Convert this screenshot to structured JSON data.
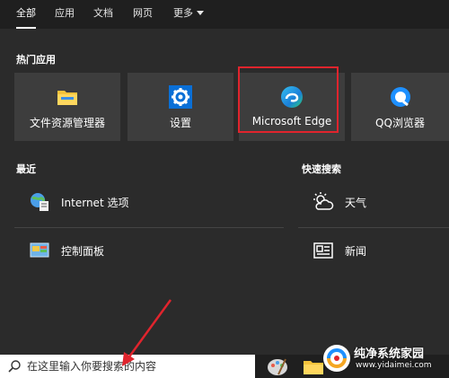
{
  "tabs": [
    {
      "label": "全部"
    },
    {
      "label": "应用"
    },
    {
      "label": "文档"
    },
    {
      "label": "网页"
    },
    {
      "label": "更多"
    }
  ],
  "hot_apps": {
    "title": "热门应用",
    "items": [
      {
        "label": "文件资源管理器",
        "icon": "folder-icon"
      },
      {
        "label": "设置",
        "icon": "gear-icon"
      },
      {
        "label": "Microsoft Edge",
        "icon": "edge-icon"
      },
      {
        "label": "QQ浏览器",
        "icon": "qq-browser-icon"
      }
    ]
  },
  "recent": {
    "title": "最近",
    "items": [
      {
        "label": "Internet 选项",
        "icon": "internet-options-icon"
      },
      {
        "label": "控制面板",
        "icon": "control-panel-icon"
      }
    ]
  },
  "quick_search": {
    "title": "快速搜索",
    "items": [
      {
        "label": "天气",
        "icon": "weather-icon"
      },
      {
        "label": "新闻",
        "icon": "news-icon"
      }
    ]
  },
  "taskbar": {
    "search_placeholder": "在这里输入你要搜索的内容"
  },
  "watermark": {
    "title": "纯净系统家园",
    "url": "www.yidaimei.com"
  },
  "colors": {
    "panel_bg": "#2b2b2b",
    "tile_bg": "#3d3d3d",
    "highlight": "#e0242d",
    "accent_blue": "#0a6fd6"
  }
}
